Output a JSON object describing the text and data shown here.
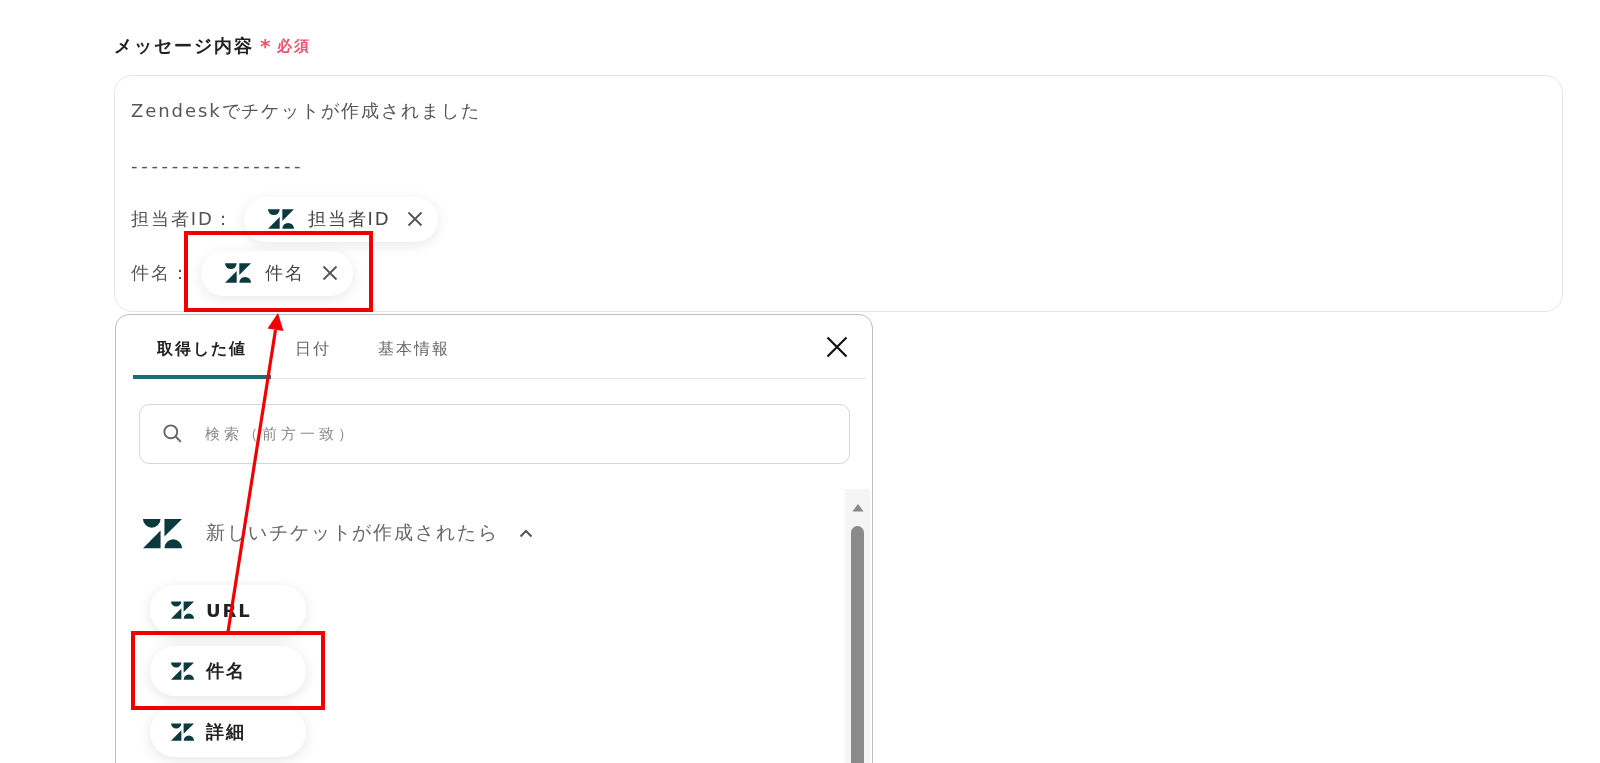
{
  "field": {
    "label": "メッセージ内容",
    "required_mark": "*",
    "required_text": "必須"
  },
  "message_lines": [
    {
      "kind": "text",
      "text": "Zendeskでチケットが作成されました"
    },
    {
      "kind": "separator",
      "text": "-----------------"
    },
    {
      "kind": "token",
      "prefix": "担当者ID：",
      "token": "担当者ID",
      "highlighted": false
    },
    {
      "kind": "token",
      "prefix": "件名：",
      "token": "件名",
      "highlighted": true
    }
  ],
  "picker": {
    "tabs": [
      {
        "label": "取得した値",
        "selected": true
      },
      {
        "label": "日付",
        "selected": false
      },
      {
        "label": "基本情報",
        "selected": false
      }
    ],
    "search": {
      "placeholder": "検索（前方一致）"
    },
    "group": {
      "title": "新しいチケットが作成されたら",
      "expanded": true,
      "items": [
        {
          "label": "URL",
          "highlighted": false
        },
        {
          "label": "件名",
          "highlighted": true
        },
        {
          "label": "詳細",
          "highlighted": false
        }
      ]
    }
  },
  "annotation": {
    "arrow": true
  }
}
